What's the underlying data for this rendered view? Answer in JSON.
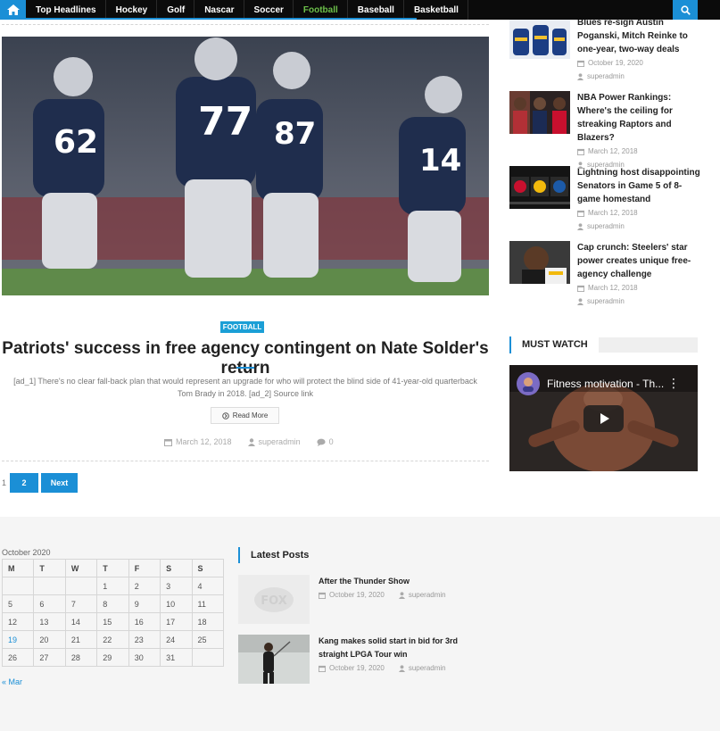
{
  "nav": {
    "items": [
      {
        "label": "Top Headlines"
      },
      {
        "label": "Hockey"
      },
      {
        "label": "Golf"
      },
      {
        "label": "Nascar"
      },
      {
        "label": "Soccer"
      },
      {
        "label": "Football"
      },
      {
        "label": "Baseball"
      },
      {
        "label": "Basketball"
      }
    ],
    "active": "Football",
    "accent_color": "#1b8fd6",
    "active_color": "#6cc04a",
    "home_icon": "home-icon",
    "search_icon": "search-icon"
  },
  "article": {
    "category": "FOOTBALL",
    "title": "Patriots' success in free agency contingent on Nate Solder's return",
    "excerpt": "[ad_1] There's no clear fall-back plan that would represent an upgrade for who will protect the blind side of 41-year-old quarterback Tom Brady in 2018. [ad_2] Source link",
    "read_more": "Read More",
    "date": "March 12, 2018",
    "author": "superadmin",
    "comments": "0"
  },
  "pagination": {
    "current": "1",
    "page2": "2",
    "next": "Next"
  },
  "sidebar": {
    "posts": [
      {
        "title": "Blues re-sign Austin Poganski, Mitch Reinke to one-year, two-way deals",
        "date": "October 19, 2020",
        "author": "superadmin"
      },
      {
        "title": "NBA Power Rankings: Where's the ceiling for streaking Raptors and Blazers?",
        "date": "March 12, 2018",
        "author": "superadmin"
      },
      {
        "title": "Lightning host disappointing Senators in Game 5 of 8-game homestand",
        "date": "March 12, 2018",
        "author": "superadmin"
      },
      {
        "title": "Cap crunch: Steelers' star power creates unique free-agency challenge",
        "date": "March 12, 2018",
        "author": "superadmin"
      }
    ],
    "must_watch": "MUST WATCH",
    "video_title": "Fitness motivation - Th..."
  },
  "footer": {
    "calendar": {
      "caption": "October 2020",
      "headers": [
        "M",
        "T",
        "W",
        "T",
        "F",
        "S",
        "S"
      ],
      "rows": [
        [
          "",
          "",
          "",
          "1",
          "2",
          "3",
          "4"
        ],
        [
          "5",
          "6",
          "7",
          "8",
          "9",
          "10",
          "11"
        ],
        [
          "12",
          "13",
          "14",
          "15",
          "16",
          "17",
          "18"
        ],
        [
          "19",
          "20",
          "21",
          "22",
          "23",
          "24",
          "25"
        ],
        [
          "26",
          "27",
          "28",
          "29",
          "30",
          "31",
          ""
        ]
      ],
      "linked_day": "19",
      "prev": "« Mar"
    },
    "latest_posts": {
      "heading": "Latest Posts",
      "posts": [
        {
          "title": "After the Thunder Show",
          "date": "October 19, 2020",
          "author": "superadmin"
        },
        {
          "title": "Kang makes solid start in bid for 3rd straight LPGA Tour win",
          "date": "October 19, 2020",
          "author": "superadmin"
        }
      ],
      "logo_text": "FOX"
    }
  }
}
